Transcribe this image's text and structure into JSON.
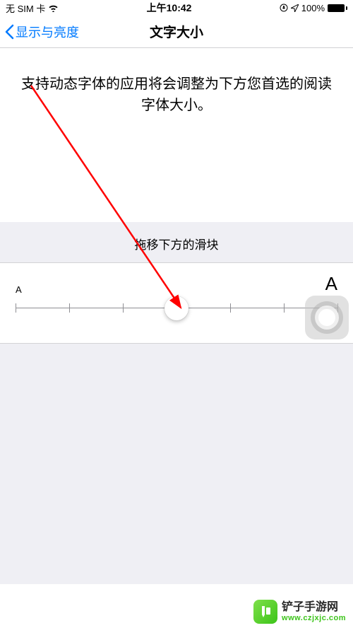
{
  "status": {
    "carrier": "无 SIM 卡",
    "time": "上午10:42",
    "battery_pct": "100%"
  },
  "nav": {
    "back_label": "显示与亮度",
    "title": "文字大小"
  },
  "description": "支持动态字体的应用将会调整为下方您首选的阅读字体大小。",
  "drag_label": "拖移下方的滑块",
  "slider": {
    "min_label": "A",
    "max_label": "A",
    "ticks": 7,
    "value_index": 3
  },
  "watermark": {
    "name": "铲子手游网",
    "url": "www.czjxjc.com"
  }
}
